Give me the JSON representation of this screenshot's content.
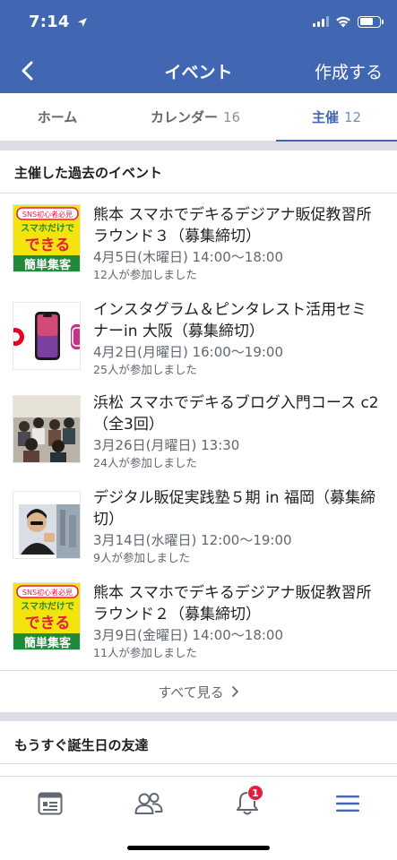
{
  "status_bar": {
    "time": "7:14"
  },
  "nav": {
    "title": "イベント",
    "create_label": "作成する"
  },
  "tabs": [
    {
      "label": "ホーム",
      "count": ""
    },
    {
      "label": "カレンダー",
      "count": "16"
    },
    {
      "label": "主催",
      "count": "12"
    }
  ],
  "past_events": {
    "heading": "主催した過去のイベント",
    "items": [
      {
        "title": "熊本 スマホでデキるデジアナ販促教習所 ラウンド３（募集締切）",
        "date": "4月5日(木曜日) 14:00〜18:00",
        "going": "12人が参加しました",
        "thumb_top": "SNS初心者必見",
        "thumb_mid": "スマホだけで",
        "thumb_big": "できる",
        "thumb_bottom": "簡単集客"
      },
      {
        "title": "インスタグラム＆ピンタレスト活用セミナーin 大阪（募集締切）",
        "date": "4月2日(月曜日) 16:00〜19:00",
        "going": "25人が参加しました"
      },
      {
        "title": "浜松 スマホでデキるブログ入門コース c2（全3回）",
        "date": "3月26日(月曜日) 13:30",
        "going": "24人が参加しました"
      },
      {
        "title": "デジタル販促実践塾５期 in 福岡（募集締切）",
        "date": "3月14日(水曜日) 12:00〜19:00",
        "going": "9人が参加しました"
      },
      {
        "title": "熊本 スマホでデキるデジアナ販促教習所 ラウンド２（募集締切）",
        "date": "3月9日(金曜日) 14:00〜18:00",
        "going": "11人が参加しました",
        "thumb_top": "SNS初心者必見",
        "thumb_mid": "スマホだけで",
        "thumb_big": "できる",
        "thumb_bottom": "簡単集客"
      }
    ],
    "see_all": "すべて見る"
  },
  "birthdays": {
    "heading": "もうすぐ誕生日の友達"
  },
  "bottom_bar": {
    "notification_badge": "1"
  },
  "colors": {
    "brand": "#4267b2",
    "badge": "#e41e3f",
    "thumb_yellow": "#f2e40c",
    "thumb_green": "#1f8a3a"
  }
}
